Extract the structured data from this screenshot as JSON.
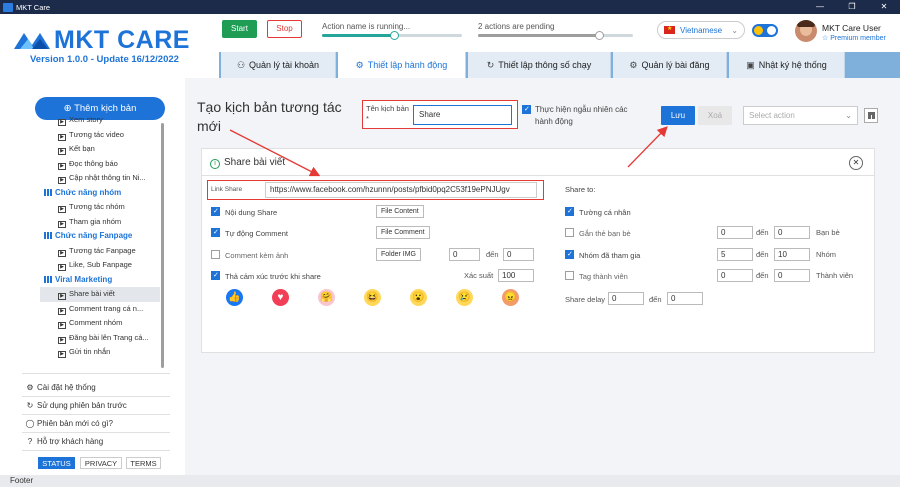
{
  "window": {
    "title": "MKT Care"
  },
  "brand": {
    "name": "MKT CARE",
    "version": "Version 1.0.0 - Update 16/12/2022"
  },
  "controls": {
    "start": "Start",
    "stop": "Stop"
  },
  "status": {
    "running": "Action name is running...",
    "running_progress": 0.52,
    "pending": "2 actions are pending",
    "pending_progress": 0.78
  },
  "language": {
    "selected": "Vietnamese"
  },
  "user": {
    "name": "MKT Care User",
    "member": "☆ Premium member"
  },
  "tabs": [
    {
      "label": "Quản lý tài khoản",
      "icon": "users-icon"
    },
    {
      "label": "Thiết lập hành động",
      "icon": "gear-icon"
    },
    {
      "label": "Thiết lập thông số chạy",
      "icon": "refresh-icon"
    },
    {
      "label": "Quản lý bài đăng",
      "icon": "gear-icon"
    },
    {
      "label": "Nhật ký hệ thống",
      "icon": "log-icon"
    }
  ],
  "sidebar": {
    "add_button": "Thêm kịch bản",
    "tree": [
      {
        "type": "child",
        "label": "Xem story"
      },
      {
        "type": "child",
        "label": "Tương tác video"
      },
      {
        "type": "child",
        "label": "Kết bạn"
      },
      {
        "type": "child",
        "label": "Đọc thông báo"
      },
      {
        "type": "child",
        "label": "Cập nhật thông tin Ni..."
      },
      {
        "type": "group",
        "label": "Chức năng nhóm"
      },
      {
        "type": "child",
        "label": "Tương tác nhóm"
      },
      {
        "type": "child",
        "label": "Tham gia nhóm"
      },
      {
        "type": "group",
        "label": "Chức năng Fanpage"
      },
      {
        "type": "child",
        "label": "Tương tác Fanpage"
      },
      {
        "type": "child",
        "label": "Like, Sub Fanpage"
      },
      {
        "type": "group",
        "label": "Viral Marketing"
      },
      {
        "type": "child",
        "label": "Share bài viết",
        "selected": true
      },
      {
        "type": "child",
        "label": "Comment trang cá n..."
      },
      {
        "type": "child",
        "label": "Comment nhóm"
      },
      {
        "type": "child",
        "label": "Đăng bài lên Trang cá..."
      },
      {
        "type": "child",
        "label": "Gửi tin nhắn"
      }
    ],
    "links": [
      {
        "label": "Cài đặt hệ thống",
        "icon": "gear-icon"
      },
      {
        "label": "Sử dụng phiên bản trước",
        "icon": "refresh-icon"
      },
      {
        "label": "Phiên bản mới có gì?",
        "icon": "chat-icon"
      },
      {
        "label": "Hỗ trợ khách hàng",
        "icon": "help-icon"
      }
    ],
    "footer_buttons": [
      "STATUS",
      "PRIVACY",
      "TERMS"
    ]
  },
  "main": {
    "title": "Tạo kịch bản tương tác mới",
    "name_label": "Tên kịch bản *",
    "name_value": "Share",
    "random_label": "Thực hiện ngẫu nhiên các hành động",
    "save": "Lưu",
    "delete": "Xoá",
    "select_action_placeholder": "Select action"
  },
  "panel": {
    "title": "Share bài viết",
    "link_label": "Link Share",
    "link_value": "https://www.facebook.com/hzunnn/posts/pfbid0pq2C53f19ePNJUgv",
    "content_label": "Nội dung Share",
    "content_btn": "File Content",
    "comment_label": "Tự động Comment",
    "comment_btn": "File Comment",
    "img_label": "Comment kèm ảnh",
    "img_btn": "Folder IMG",
    "img_from": "0",
    "img_to_label": "đến",
    "img_to": "0",
    "react_label": "Thả cảm xúc trước khi share",
    "prob_label": "Xác suất",
    "prob_value": "100",
    "share_to_title": "Share to:",
    "share_wall": "Tường cá nhân",
    "tag_label": "Gắn thẻ bạn bè",
    "tag_from": "0",
    "tag_to": "0",
    "tag_unit": "Bạn bè",
    "group_label": "Nhóm đã tham gia",
    "group_from": "5",
    "group_to": "10",
    "group_unit": "Nhóm",
    "member_label": "Tag thành viên",
    "member_from": "0",
    "member_to": "0",
    "member_unit": "Thành viên",
    "to_label": "đến",
    "delay_label": "Share delay",
    "delay_from": "0",
    "delay_to": "0"
  },
  "footer": {
    "label": "Footer"
  },
  "colors": {
    "accent": "#1d73d8",
    "highlight": "#e53935",
    "start": "#1f9d55"
  }
}
